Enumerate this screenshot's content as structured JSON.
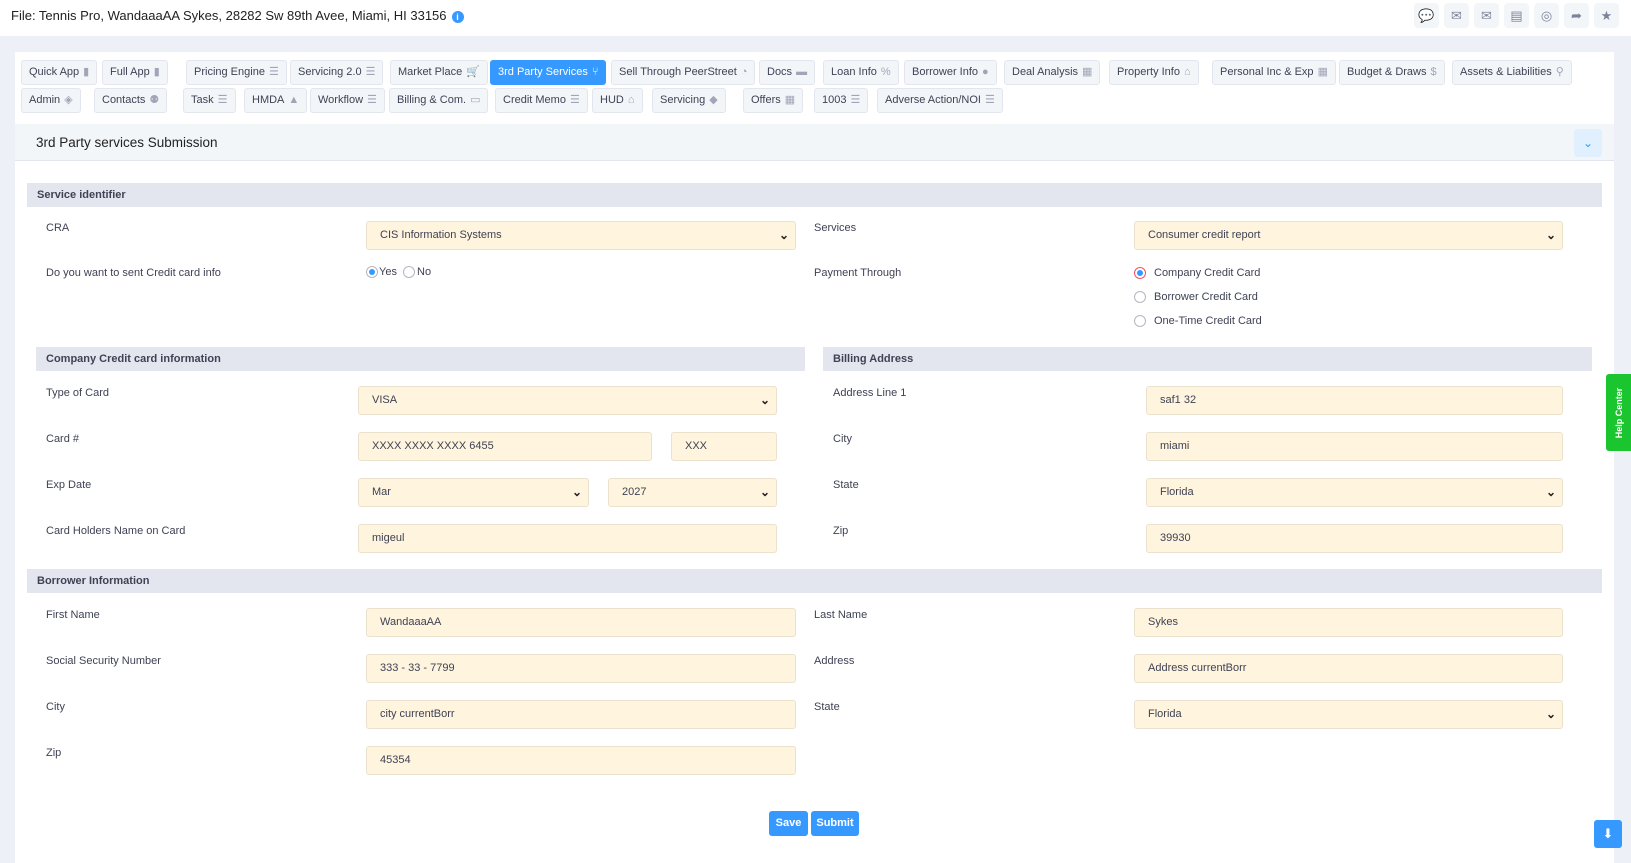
{
  "header": {
    "file_title": "File: Tennis Pro, WandaaaAA Sykes, 28282 Sw 89th Avee, Miami, HI 33156",
    "icons": [
      "chat-icon",
      "envelope-open-icon",
      "mail-icon",
      "document-icon",
      "support-icon",
      "share-icon",
      "star-icon"
    ]
  },
  "tabs": [
    {
      "label": "Quick App",
      "icon": "▮",
      "row": 0
    },
    {
      "label": "Full App",
      "icon": "▮",
      "row": 0
    },
    {
      "label": "Pricing Engine",
      "icon": "☰",
      "row": 0
    },
    {
      "label": "Servicing 2.0",
      "icon": "☰",
      "row": 0
    },
    {
      "label": "Market Place",
      "icon": "🛒",
      "row": 0
    },
    {
      "label": "3rd Party Services",
      "icon": "⑂",
      "row": 0,
      "active": true
    },
    {
      "label": "Sell Through PeerStreet",
      "icon": "◔",
      "row": 0
    },
    {
      "label": "Docs",
      "icon": "▬",
      "row": 0
    },
    {
      "label": "Loan Info",
      "icon": "%",
      "row": 0
    },
    {
      "label": "Borrower Info",
      "icon": "●",
      "row": 0
    },
    {
      "label": "Deal Analysis",
      "icon": "▦",
      "row": 0
    },
    {
      "label": "Property Info",
      "icon": "⌂",
      "row": 0
    },
    {
      "label": "Personal Inc & Exp",
      "icon": "▦",
      "row": 0
    },
    {
      "label": "Budget & Draws",
      "icon": "$",
      "row": 0
    },
    {
      "label": "Assets & Liabilities",
      "icon": "⚲",
      "row": 0
    },
    {
      "label": "Admin",
      "icon": "◈",
      "row": 1
    },
    {
      "label": "Contacts",
      "icon": "⚉",
      "row": 1
    },
    {
      "label": "Task",
      "icon": "☰",
      "row": 1
    },
    {
      "label": "HMDA",
      "icon": "▲",
      "row": 1
    },
    {
      "label": "Workflow",
      "icon": "☰",
      "row": 1
    },
    {
      "label": "Billing & Com.",
      "icon": "▭",
      "row": 1
    },
    {
      "label": "Credit Memo",
      "icon": "☰",
      "row": 1
    },
    {
      "label": "HUD",
      "icon": "⌂",
      "row": 1
    },
    {
      "label": "Servicing",
      "icon": "◆",
      "row": 1
    },
    {
      "label": "Offers",
      "icon": "▦",
      "row": 1
    },
    {
      "label": "1003",
      "icon": "☰",
      "row": 1
    },
    {
      "label": "Adverse Action/NOI",
      "icon": "☰",
      "row": 1
    }
  ],
  "panel": {
    "title": "3rd Party services Submission"
  },
  "service": {
    "section": "Service identifier",
    "cra_label": "CRA",
    "cra_value": "CIS Information Systems",
    "services_label": "Services",
    "services_value": "Consumer credit report",
    "send_cc_label": "Do you want to sent Credit card info",
    "yes": "Yes",
    "no": "No",
    "send_cc_selected": "Yes",
    "payment_label": "Payment Through",
    "payment_options": [
      "Company Credit Card",
      "Borrower Credit Card",
      "One-Time Credit Card"
    ],
    "payment_selected": "Company Credit Card"
  },
  "company_card": {
    "section": "Company Credit card information",
    "type_label": "Type of Card",
    "type_value": "VISA",
    "card_label": "Card #",
    "card_value": "XXXX XXXX XXXX 6455",
    "cvv_value": "XXX",
    "exp_label": "Exp Date",
    "exp_month": "Mar",
    "exp_year": "2027",
    "holder_label": "Card Holders Name on Card",
    "holder_value": "migeul"
  },
  "billing": {
    "section": "Billing Address",
    "addr_label": "Address Line 1",
    "addr_value": "saf1 32",
    "city_label": "City",
    "city_value": "miami",
    "state_label": "State",
    "state_value": "Florida",
    "zip_label": "Zip",
    "zip_value": "39930"
  },
  "borrower": {
    "section": "Borrower Information",
    "first_label": "First Name",
    "first_value": "WandaaaAA",
    "last_label": "Last Name",
    "last_value": "Sykes",
    "ssn_label": "Social Security Number",
    "ssn_value": "333 - 33 - 7799",
    "address_label": "Address",
    "address_value": "Address currentBorr",
    "city_label": "City",
    "city_value": "city currentBorr",
    "state_label": "State",
    "state_value": "Florida",
    "zip_label": "Zip",
    "zip_value": "45354"
  },
  "actions": {
    "save": "Save",
    "submit": "Submit"
  },
  "help_center": "Help Center",
  "colors": {
    "accent": "#3699ff",
    "field_bg": "#fff4de",
    "help": "#1bc530"
  }
}
